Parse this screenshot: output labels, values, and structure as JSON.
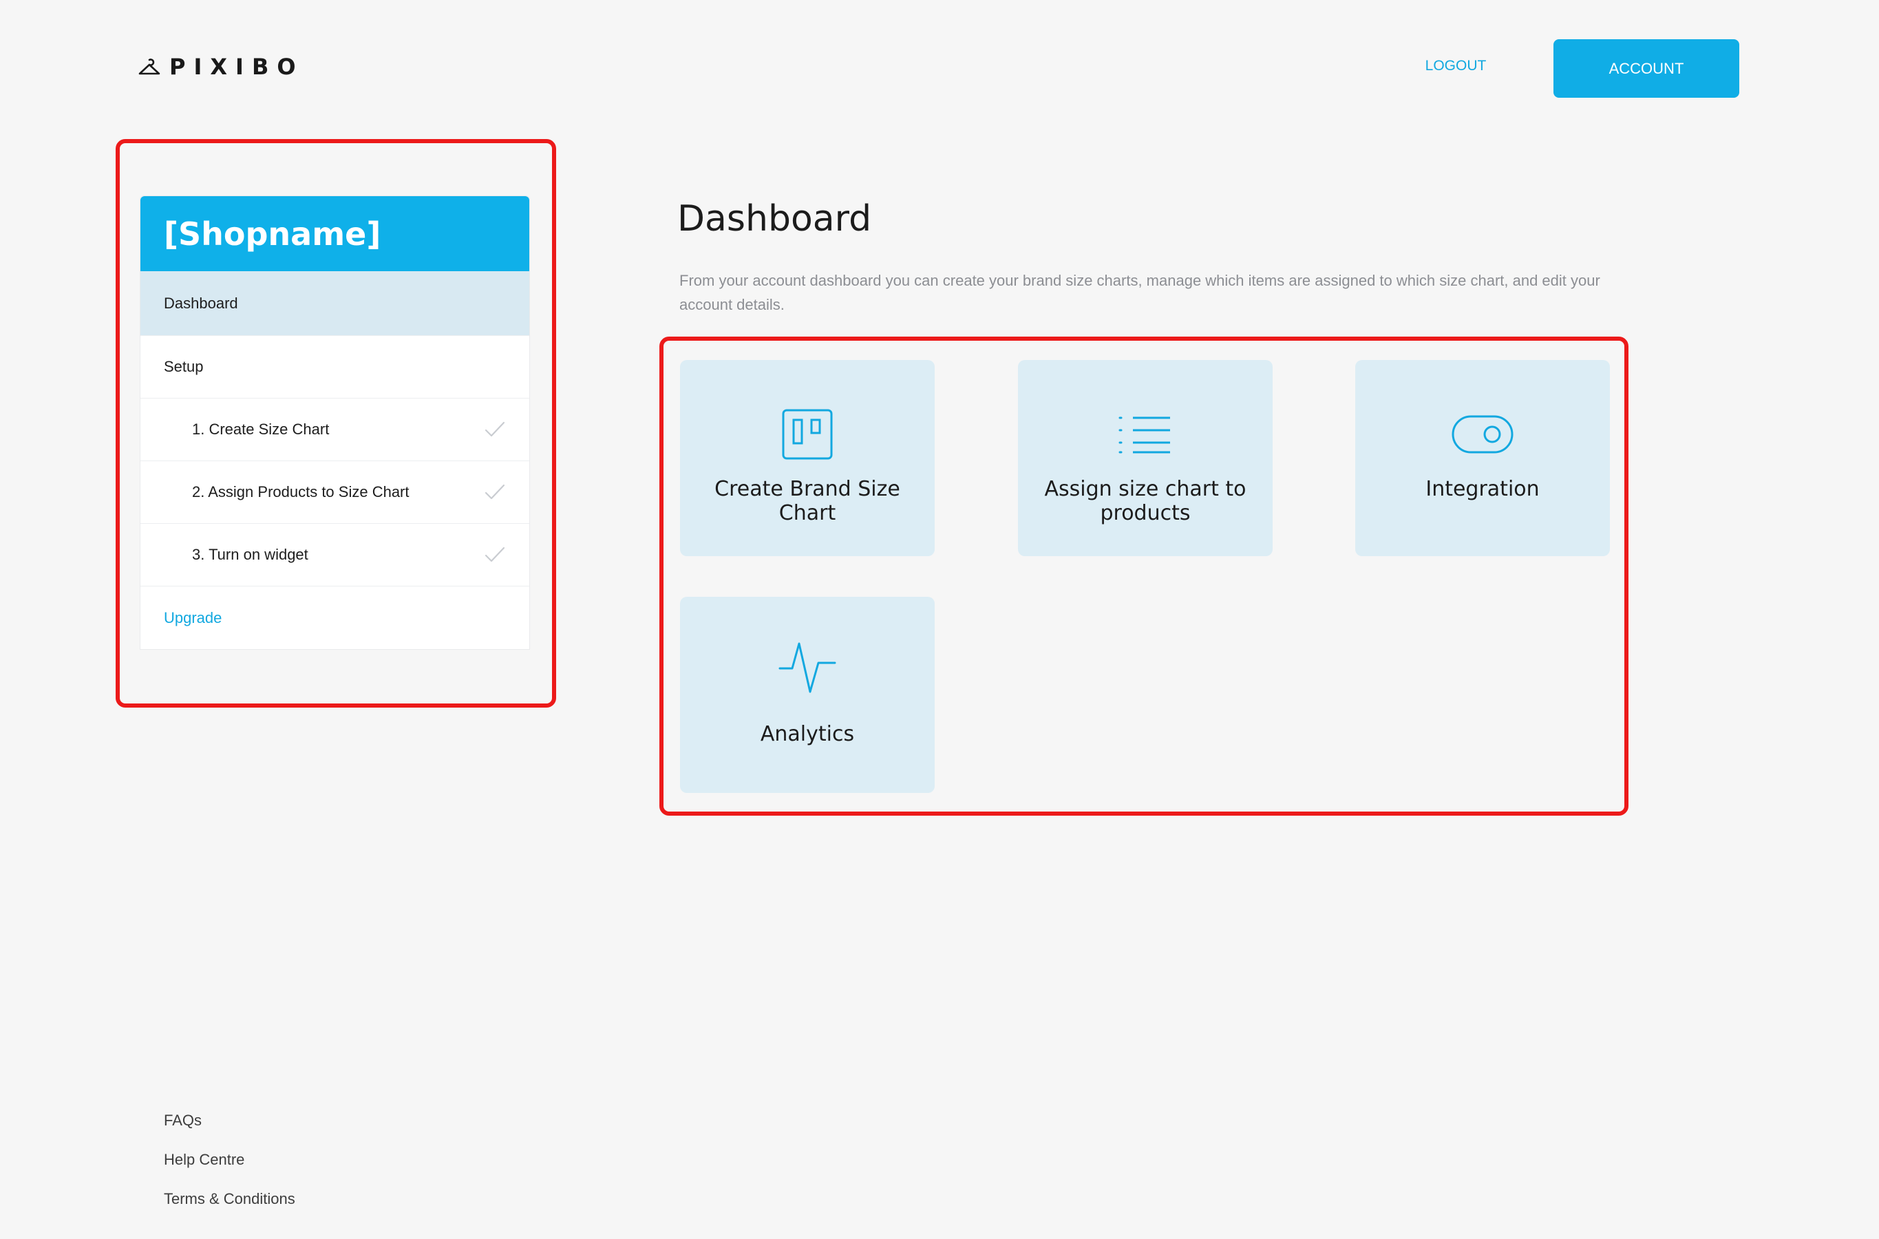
{
  "header": {
    "logo_text": "PIXIBO",
    "logout_label": "LOGOUT",
    "account_label": "ACCOUNT"
  },
  "sidebar": {
    "shop_name": "[Shopname]",
    "items": [
      {
        "label": "Dashboard",
        "active": true
      },
      {
        "label": "Setup"
      },
      {
        "label": "1. Create Size Chart",
        "completed": true
      },
      {
        "label": "2. Assign Products to Size Chart",
        "completed": true
      },
      {
        "label": "3. Turn on widget",
        "completed": true
      },
      {
        "label": "Upgrade"
      }
    ]
  },
  "main": {
    "title": "Dashboard",
    "description": "From your account dashboard you can create your brand size charts, manage which items are assigned to which size chart, and edit your account details.",
    "cards": [
      {
        "label": "Create Brand Size Chart",
        "icon": "board-icon"
      },
      {
        "label": "Assign size chart to products",
        "icon": "list-icon"
      },
      {
        "label": "Integration",
        "icon": "toggle-icon"
      },
      {
        "label": "Analytics",
        "icon": "pulse-icon"
      }
    ]
  },
  "footer": {
    "links": [
      "FAQs",
      "Help Centre",
      "Terms & Conditions"
    ]
  },
  "colors": {
    "accent": "#10ade6",
    "card_background": "#dcedf5",
    "active_item_background": "#d8e9f2",
    "highlight_outline": "#ec1a1a",
    "page_background": "#f6f6f6"
  }
}
